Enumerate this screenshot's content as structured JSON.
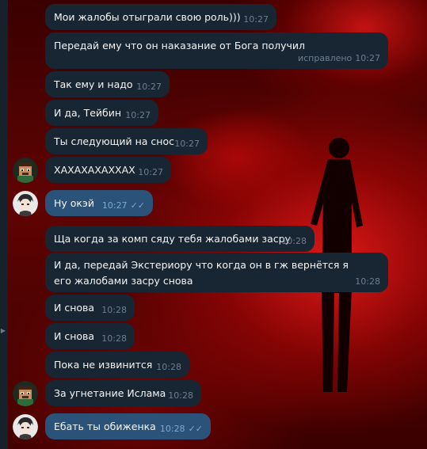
{
  "chat": {
    "messages": [
      {
        "text": "Мои жалобы отыграли свою роль)))",
        "time": "10:27"
      },
      {
        "text": "Передай ему что он наказание от Бога получил",
        "edited": "исправлено",
        "time": "10:27"
      },
      {
        "text": "Так ему и надо",
        "time": "10:27"
      },
      {
        "text": "И да, Тейбин",
        "time": "10:27"
      },
      {
        "text": "Ты следующий на снос",
        "time": "10:27"
      },
      {
        "text": "ХАХАХАХАХХАХ",
        "time": "10:27"
      },
      {
        "text": "Ну окэй",
        "time": "10:27"
      },
      {
        "text": "Ща когда за комп сяду тебя жалобами засру",
        "time": "10:28"
      },
      {
        "text": "И да, передай Экстериору что когда он в гж вернётся я его жалобами засру снова",
        "time": "10:28"
      },
      {
        "text": "И снова",
        "time": "10:28"
      },
      {
        "text": "И снова",
        "time": "10:28"
      },
      {
        "text": "Пока не извинится",
        "time": "10:28"
      },
      {
        "text": "За угнетание Ислама",
        "time": "10:28"
      },
      {
        "text": "Ебать ты обиженка",
        "time": "10:28"
      }
    ],
    "read_ticks": "✓✓"
  },
  "colors": {
    "incoming_bubble": "#182533",
    "outgoing_bubble": "#2b5278",
    "wallpaper": "#c41010"
  },
  "icons": [
    "pixel-avatar-icon",
    "anime-avatar-icon",
    "read-ticks-icon",
    "scroll-down-arrow-icon"
  ]
}
